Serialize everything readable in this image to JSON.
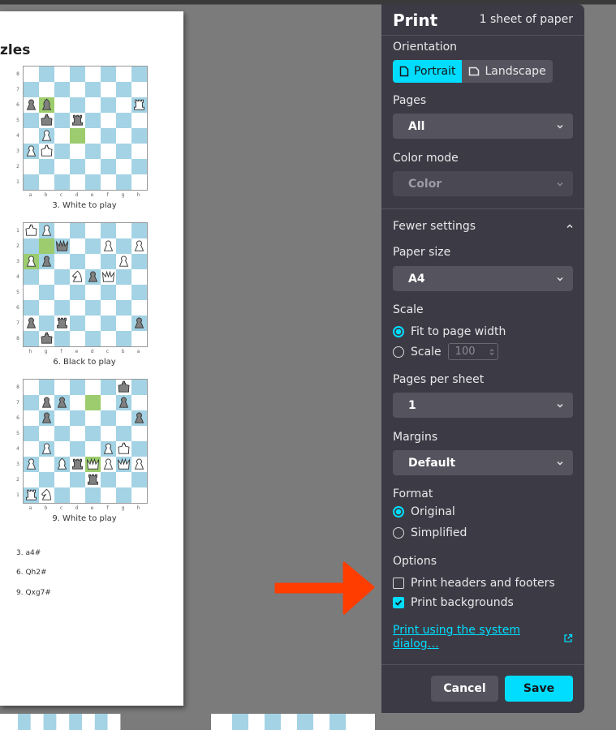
{
  "preview": {
    "title_fragment": "zles",
    "rank_labels_white": [
      "8",
      "7",
      "6",
      "5",
      "4",
      "3",
      "2",
      "1"
    ],
    "rank_labels_black": [
      "1",
      "2",
      "3",
      "4",
      "5",
      "6",
      "7",
      "8"
    ],
    "file_labels_white": [
      "a",
      "b",
      "c",
      "d",
      "e",
      "f",
      "g",
      "h"
    ],
    "file_labels_black": [
      "h",
      "g",
      "f",
      "e",
      "d",
      "c",
      "b",
      "a"
    ],
    "captions": [
      "3. White to play",
      "6. Black to play",
      "9. White to play"
    ],
    "solutions": [
      "3. a4#",
      "6. Qh2#",
      "9. Qxg7#"
    ],
    "board_colors": {
      "light": "#ffffff",
      "dark": "#a3d3e4",
      "highlight": "#9ccc6e"
    },
    "pieces": {
      "white": "#ffffff",
      "black": "#808080"
    }
  },
  "panel": {
    "title": "Print",
    "sheet_count": "1 sheet of paper",
    "orientation": {
      "label": "Orientation",
      "portrait": "Portrait",
      "landscape": "Landscape",
      "selected": "Portrait"
    },
    "pages": {
      "label": "Pages",
      "value": "All"
    },
    "color_mode": {
      "label": "Color mode",
      "value": "Color"
    },
    "fewer_settings": "Fewer settings",
    "paper_size": {
      "label": "Paper size",
      "value": "A4"
    },
    "scale": {
      "label": "Scale",
      "fit": "Fit to page width",
      "custom": "Scale",
      "value": "100"
    },
    "pages_per_sheet": {
      "label": "Pages per sheet",
      "value": "1"
    },
    "margins": {
      "label": "Margins",
      "value": "Default"
    },
    "format": {
      "label": "Format",
      "original": "Original",
      "simplified": "Simplified"
    },
    "options": {
      "label": "Options",
      "headers_footers": "Print headers and footers",
      "backgrounds": "Print backgrounds"
    },
    "system_dialog": "Print using the system dialog…",
    "cancel": "Cancel",
    "save": "Save"
  },
  "colors": {
    "accent": "#00ddff",
    "panel_bg": "#3c3b45",
    "arrow": "#ff3d00"
  },
  "icons": [
    "page-portrait-icon",
    "page-landscape-icon",
    "chevron-down-icon",
    "chevron-up-icon",
    "external-link-icon",
    "arrow-right-icon"
  ]
}
